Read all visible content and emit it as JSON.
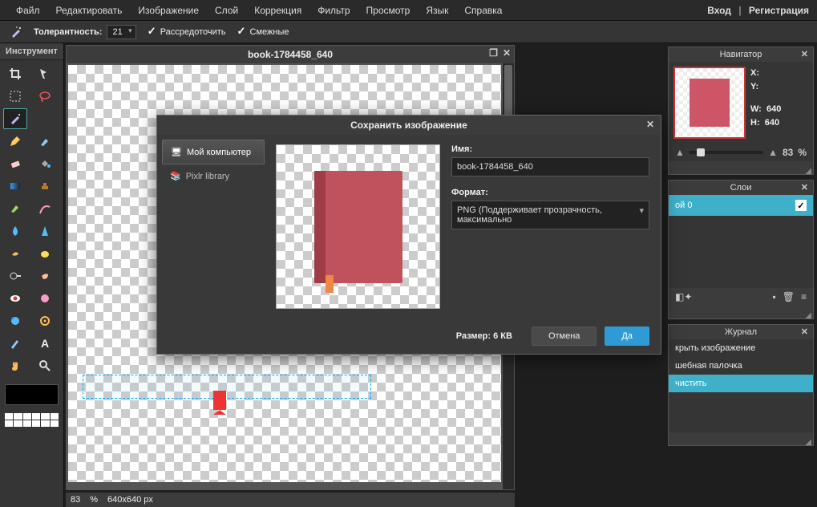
{
  "menu": {
    "items": [
      "Файл",
      "Редактировать",
      "Изображение",
      "Слой",
      "Коррекция",
      "Фильтр",
      "Просмотр",
      "Язык",
      "Справка"
    ],
    "login": "Вход",
    "register": "Регистрация"
  },
  "toolbar": {
    "tolerance_label": "Толерантность:",
    "tolerance_value": "21",
    "opt1_label": "Рассредоточить",
    "opt2_label": "Смежные"
  },
  "tools": {
    "panel_title": "Инструмент"
  },
  "document": {
    "title": "book-1784458_640",
    "zoom": "83",
    "zoom_unit": "%",
    "dims": "640x640 px"
  },
  "navigator": {
    "title": "Навигатор",
    "x_label": "X:",
    "y_label": "Y:",
    "w_label": "W:",
    "h_label": "H:",
    "w_value": "640",
    "h_value": "640",
    "zoom": "83",
    "zoom_unit": "%"
  },
  "layers": {
    "title": "Слои",
    "row0": "ой 0"
  },
  "history": {
    "title": "Журнал",
    "row0": "крыть изображение",
    "row1": "шебная палочка",
    "row2": "чистить"
  },
  "dialog": {
    "title": "Сохранить изображение",
    "side0": "Мой компьютер",
    "side1": "Pixlr library",
    "name_label": "Имя:",
    "name_value": "book-1784458_640",
    "format_label": "Формат:",
    "format_value": "PNG (Поддерживает прозрачность, максимально",
    "size_label": "Размер: 6 КВ",
    "cancel": "Отмена",
    "ok": "Да"
  }
}
